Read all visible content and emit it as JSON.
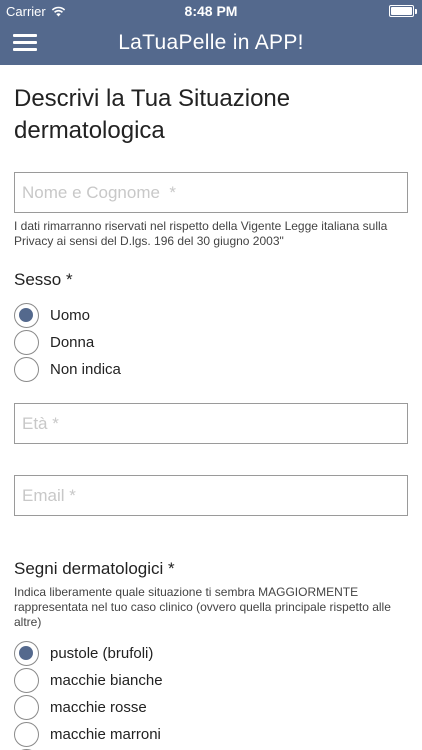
{
  "status_bar": {
    "carrier": "Carrier",
    "time": "8:48 PM"
  },
  "nav": {
    "title": "LaTuaPelle in APP!"
  },
  "page": {
    "title": "Descrivi la Tua Situazione dermatologica"
  },
  "form": {
    "name_placeholder": "Nome e Cognome  *",
    "privacy_note": "I dati rimarranno riservati nel rispetto della Vigente Legge italiana sulla Privacy ai sensi del D.lgs. 196 del 30 giugno 2003\"",
    "sex": {
      "label": "Sesso *",
      "options": [
        {
          "label": "Uomo",
          "checked": true
        },
        {
          "label": "Donna",
          "checked": false
        },
        {
          "label": "Non indica",
          "checked": false
        }
      ]
    },
    "age_placeholder": "Età *",
    "email_placeholder": "Email *",
    "signs": {
      "label": "Segni dermatologici *",
      "description": "Indica liberamente quale situazione ti sembra MAGGIORMENTE rappresentata nel tuo caso clinico (ovvero quella principale rispetto alle altre)",
      "options": [
        {
          "label": "pustole (brufoli)",
          "checked": true
        },
        {
          "label": "macchie bianche",
          "checked": false
        },
        {
          "label": "macchie rosse",
          "checked": false
        },
        {
          "label": "macchie marroni",
          "checked": false
        },
        {
          "label": "",
          "checked": false
        }
      ]
    }
  },
  "colors": {
    "nav_bg": "#54698d",
    "radio_fill": "#54698d"
  }
}
